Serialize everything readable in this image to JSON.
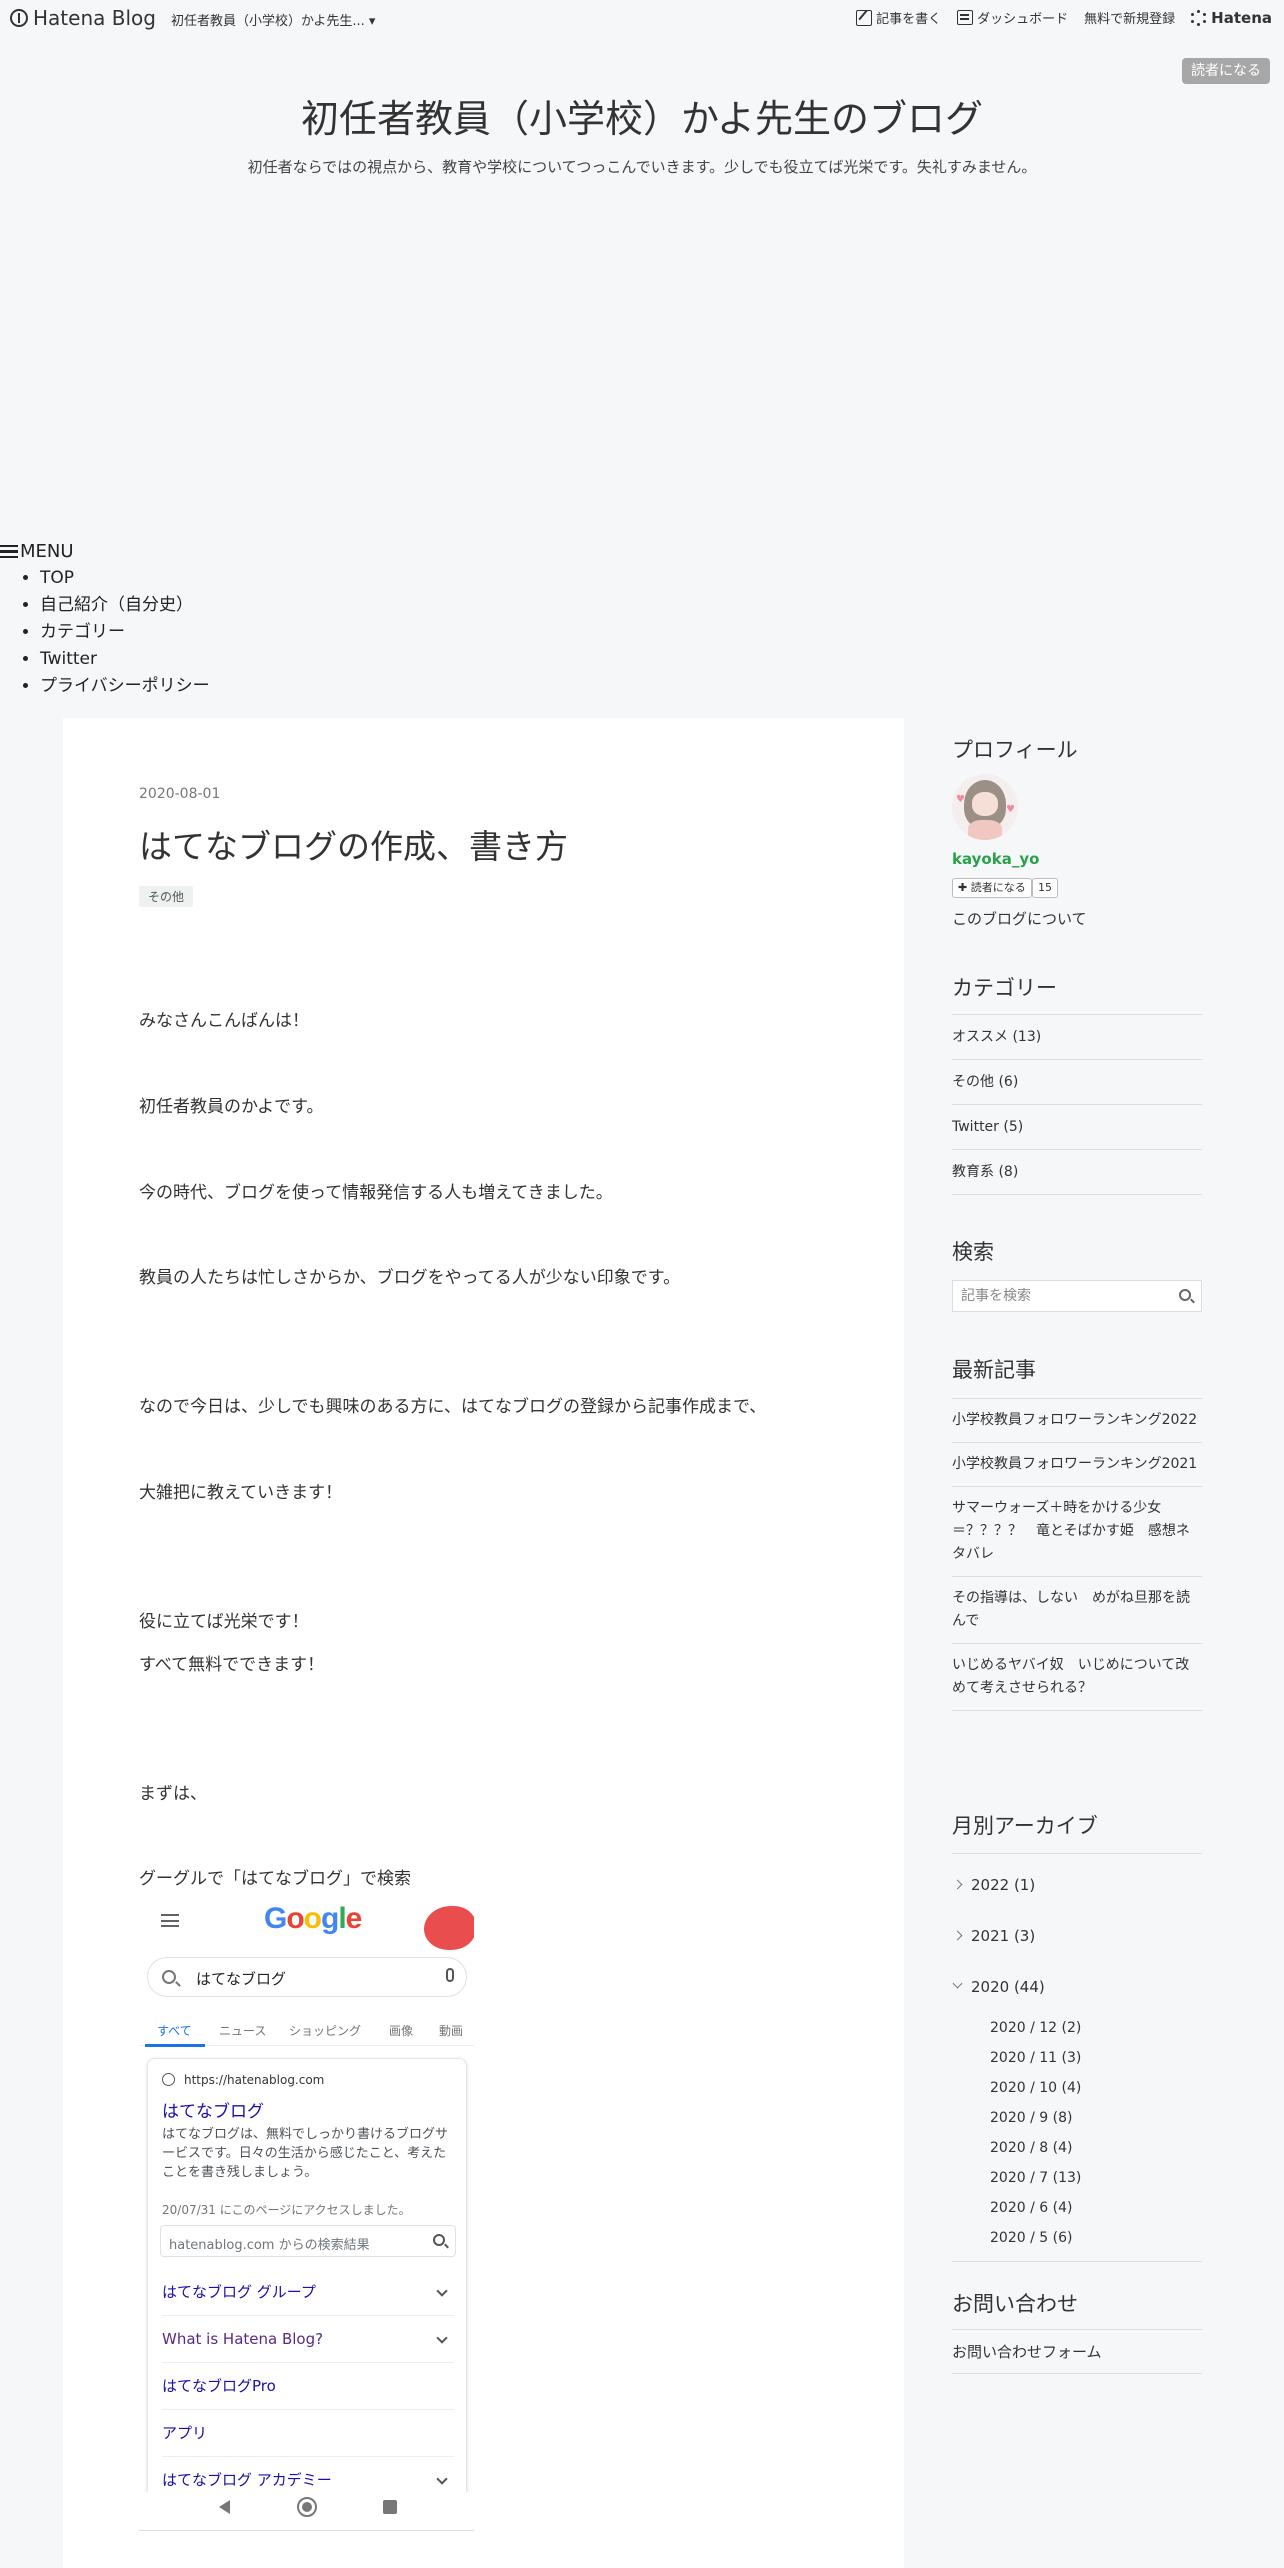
{
  "header": {
    "brand": "Hatena Blog",
    "blog_switch": "初任者教員（小学校）かよ先生... ▾",
    "write": "記事を書く",
    "dashboard": "ダッシュボード",
    "signup": "無料で新規登録",
    "hatena": "Hatena",
    "subscribe": "読者になる"
  },
  "blog": {
    "title": "初任者教員（小学校）かよ先生のブログ",
    "description": "初任者ならではの視点から、教育や学校についてつっこんでいきます。少しでも役立てば光栄です。失礼すみません。"
  },
  "menu": {
    "toggle": "MENU",
    "items": [
      "TOP",
      "自己紹介（自分史）",
      "カテゴリー",
      "Twitter",
      "プライバシーポリシー"
    ]
  },
  "article": {
    "date": "2020-08-01",
    "title": "はてなブログの作成、書き方",
    "tag": "その他",
    "paragraphs": [
      "みなさんこんばんは！",
      "初任者教員のかよです。",
      "今の時代、ブログを使って情報発信する人も増えてきました。",
      "教員の人たちは忙しさからか、ブログをやってる人が少ない印象です。",
      "なので今日は、少しでも興味のある方に、はてなブログの登録から記事作成まで、",
      "大雑把に教えていきます！",
      "役に立てば光栄です！",
      "すべて無料でできます！",
      "まずは、",
      "グーグルで「はてなブログ」で検索"
    ]
  },
  "screenshot": {
    "logo": "Google",
    "query": "はてなブログ",
    "tabs": [
      "すべて",
      "ニュース",
      "ショッピング",
      "画像",
      "動画"
    ],
    "url": "https://hatenablog.com",
    "result_title": "はてなブログ",
    "snippet": "はてなブログは、無料でしっかり書けるブログサービスです。日々の生活から感じたこと、考えたことを書き残しましょう。",
    "visited": "20/07/31 にこのページにアクセスしました。",
    "site_search": "hatenablog.com からの検索結果",
    "links": [
      "はてなブログ グループ",
      "What is Hatena Blog?",
      "はてなブログPro",
      "アプリ",
      "はてなブログ アカデミー"
    ]
  },
  "sidebar": {
    "profile": {
      "heading": "プロフィール",
      "name": "kayoka_yo",
      "subscribe": "読者になる",
      "count": "15",
      "about": "このブログについて"
    },
    "categories": {
      "heading": "カテゴリー",
      "items": [
        "オススメ (13)",
        "その他 (6)",
        "Twitter (5)",
        "教育系 (8)"
      ]
    },
    "search": {
      "heading": "検索",
      "placeholder": "記事を検索"
    },
    "recent": {
      "heading": "最新記事",
      "items": [
        "小学校教員フォロワーランキング2022",
        "小学校教員フォロワーランキング2021",
        "サマーウォーズ＋時をかける少女＝？？？？　竜とそばかす姫　感想ネタバレ",
        "その指導は、しない　めがね旦那を読んで",
        "いじめるヤバイ奴　いじめについて改めて考えさせられる？"
      ]
    },
    "archive": {
      "heading": "月別アーカイブ",
      "years": [
        "2022 (1)",
        "2021 (3)",
        "2020 (44)"
      ],
      "months": [
        "2020 / 12 (2)",
        "2020 / 11 (3)",
        "2020 / 10 (4)",
        "2020 / 9 (8)",
        "2020 / 8 (4)",
        "2020 / 7 (13)",
        "2020 / 6 (4)",
        "2020 / 5 (6)"
      ]
    },
    "contact": {
      "heading": "お問い合わせ",
      "link": "お問い合わせフォーム"
    }
  }
}
